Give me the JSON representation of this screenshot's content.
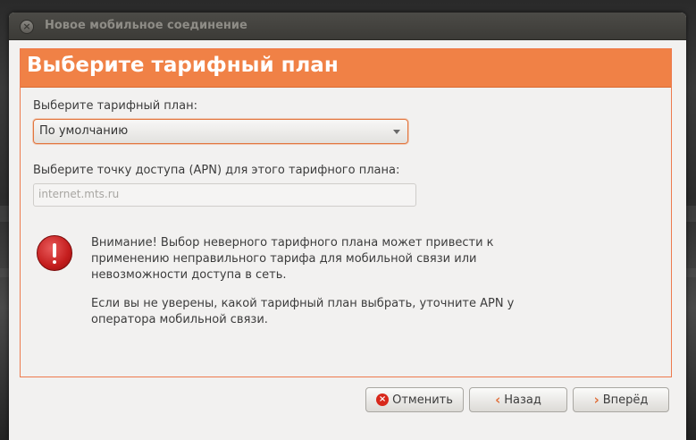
{
  "window": {
    "title": "Новое мобильное соединение"
  },
  "banner": {
    "title": "Выберите тарифный план"
  },
  "plan": {
    "label": "Выберите тарифный план:",
    "selected": "По умолчанию"
  },
  "apn": {
    "label": "Выберите точку доступа (APN) для этого тарифного плана:",
    "value": "internet.mts.ru"
  },
  "warning": {
    "line1": "Внимание! Выбор неверного тарифного плана может привести к",
    "line2": "применению неправильного тарифа для мобильной связи или",
    "line3": "невозможности доступа в сеть.",
    "line4": "Если вы не уверены, какой тарифный план выбрать, уточните APN у",
    "line5": "оператора мобильной связи."
  },
  "buttons": {
    "cancel": "Отменить",
    "back": "Назад",
    "forward": "Вперёд"
  },
  "colors": {
    "accent": "#f08146",
    "warning_icon": "#c41d1d",
    "titlebar": "#3c3b37"
  },
  "icons": {
    "close": "close-icon",
    "warning": "warning-icon",
    "cancel": "cancel-icon",
    "back": "chevron-left-icon",
    "forward": "chevron-right-icon",
    "dropdown": "chevron-down-icon"
  }
}
